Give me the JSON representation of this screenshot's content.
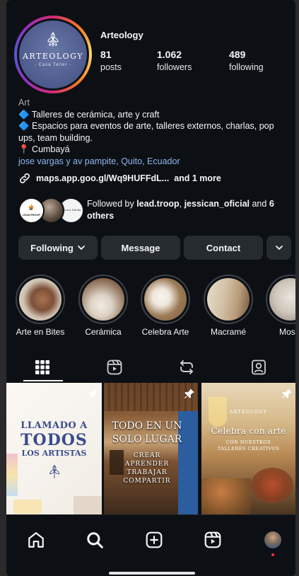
{
  "profile": {
    "username": "Arteology",
    "avatar_name": "ARTEOLOGY",
    "avatar_sub": "- Casa Taller -",
    "stats": [
      {
        "value": "81",
        "label": "posts"
      },
      {
        "value": "1.062",
        "label": "followers"
      },
      {
        "value": "489",
        "label": "following"
      }
    ]
  },
  "bio": {
    "category": "Art",
    "line1": "🔷 Talleres de cerámica, arte y craft",
    "line2": "🔷 Espacios para eventos de arte, talleres externos, charlas, pop ups, team building.",
    "line3": "📍 Cumbayá",
    "location": "jose vargas y av pampite, Quito, Ecuador",
    "link": "maps.app.goo.gl/Wq9HUFFdL...",
    "link_more": "and 1 more"
  },
  "followed_by": {
    "prefix": "Followed by",
    "name1": "lead.troop",
    "sep": ",",
    "name2": "jessican_oficial",
    "and": "and",
    "others": "6 others",
    "avatar1_text": "LEADTROOP",
    "avatar3_text": "Jessica Dávila"
  },
  "buttons": {
    "following": "Following",
    "message": "Message",
    "contact": "Contact"
  },
  "highlights": [
    {
      "label": "Arte en Bites"
    },
    {
      "label": "Cerámica"
    },
    {
      "label": "Celebra Arte"
    },
    {
      "label": "Macramé"
    },
    {
      "label": "Mosai"
    }
  ],
  "posts": [
    {
      "line1": "LLAMADO A",
      "line2": "TODOS",
      "line3": "LOS ARTISTAS"
    },
    {
      "title": "TODO EN UN SOLO LUGAR",
      "w1": "CREAR",
      "w2": "APRENDER",
      "w3": "TRABAJAR",
      "w4": "COMPARTIR"
    },
    {
      "brand": "ARTEOLOGY",
      "title": "Celebra con arte",
      "sub": "CON NUESTROS TALLERES CREATIVOS"
    }
  ],
  "colors": {
    "background": "#0c1014",
    "button": "#262b30",
    "link": "#8fb5f0",
    "notification_dot": "#ff3040"
  }
}
